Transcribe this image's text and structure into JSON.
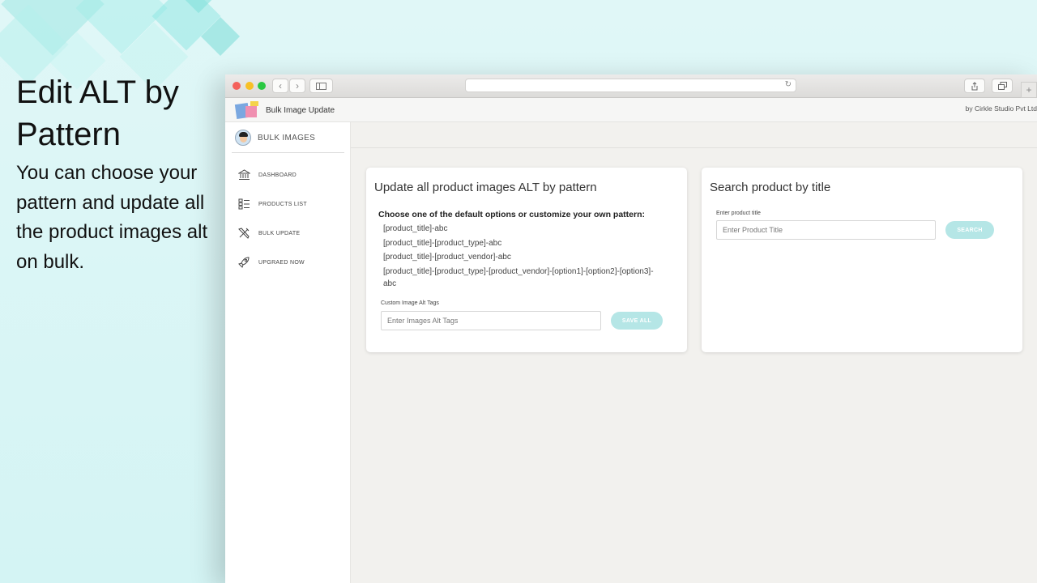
{
  "promo": {
    "title": "Edit ALT by Pattern",
    "description": "You can choose your pattern and update all the product images alt on bulk."
  },
  "browser": {
    "address_value": ""
  },
  "app": {
    "name": "Bulk Image Update",
    "vendor": "by Cirkle Studio Pvt Ltd"
  },
  "sidebar": {
    "brand": "BULK IMAGES",
    "items": [
      {
        "label": "DASHBOARD",
        "icon": "bank-icon"
      },
      {
        "label": "PRODUCTS LIST",
        "icon": "list-icon"
      },
      {
        "label": "BULK UPDATE",
        "icon": "tools-icon"
      },
      {
        "label": "UPGRAED NOW",
        "icon": "rocket-icon"
      }
    ]
  },
  "alt_card": {
    "title": "Update all product images ALT by pattern",
    "hint": "Choose one of the default options or customize your own pattern:",
    "patterns": [
      "[product_title]-abc",
      "[product_title]-[product_type]-abc",
      "[product_title]-[product_vendor]-abc",
      "[product_title]-[product_type]-[product_vendor]-[option1]-[option2]-[option3]-abc"
    ],
    "field_label": "Custom Image Alt Tags",
    "field_placeholder": "Enter Images Alt Tags",
    "button": "SAVE ALL"
  },
  "search_card": {
    "title": "Search product by title",
    "field_label": "Enter product title",
    "field_placeholder": "Enter Product Title",
    "button": "SEARCH"
  },
  "colors": {
    "background": "#d9f5f5",
    "button": "#b5e6e6",
    "content_bg": "#f2f1ee"
  }
}
